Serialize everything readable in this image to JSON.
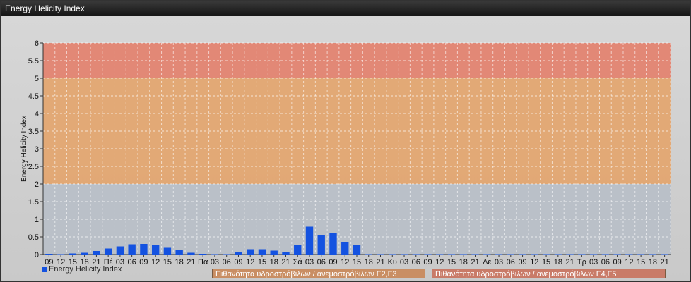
{
  "window": {
    "title": "Energy Helicity Index"
  },
  "colors": {
    "bar": "#1452e0",
    "band_low": "#b8bfc8",
    "band_mid": "#e3a46c",
    "band_high": "#e3806c",
    "legend_mid": "#c98e63",
    "legend_high": "#c97b68"
  },
  "legend": {
    "series_label": "Energy Helicity Index",
    "band_mid_label": "Πιθανότητα υδροστρόβιλων / ανεμοστρόβιλων F2,F3",
    "band_high_label": "Πιθανότητα υδροστρόβιλων / ανεμοστρόβιλων F4,F5"
  },
  "chart_data": {
    "type": "bar",
    "ylabel": "Energy Helicity Index",
    "ylim": [
      0,
      6
    ],
    "yticks": [
      "0",
      "0.5",
      "1",
      "1.5",
      "2",
      "2.5",
      "3",
      "3.5",
      "4",
      "4.5",
      "5",
      "5.5",
      "6"
    ],
    "bands": [
      {
        "from": 0,
        "to": 2,
        "label": ""
      },
      {
        "from": 2,
        "to": 5,
        "label": "Πιθανότητα υδροστρόβιλων / ανεμοστρόβιλων F2,F3"
      },
      {
        "from": 5,
        "to": 6,
        "label": "Πιθανότητα υδροστρόβιλων / ανεμοστρόβιλων F4,F5"
      }
    ],
    "grid": true,
    "categories": [
      "09",
      "12",
      "15",
      "18",
      "21",
      "Πέ",
      "03",
      "06",
      "09",
      "12",
      "15",
      "18",
      "21",
      "Πα",
      "03",
      "06",
      "09",
      "12",
      "15",
      "18",
      "21",
      "Σά",
      "03",
      "06",
      "09",
      "12",
      "15",
      "18",
      "21",
      "Κυ",
      "03",
      "06",
      "09",
      "12",
      "15",
      "18",
      "21",
      "Δε",
      "03",
      "06",
      "09",
      "12",
      "15",
      "18",
      "21",
      "Τρ",
      "03",
      "06",
      "09",
      "12",
      "15",
      "18",
      "21"
    ],
    "series": [
      {
        "name": "Energy Helicity Index",
        "values": [
          0.02,
          0.01,
          0.03,
          0.05,
          0.1,
          0.17,
          0.23,
          0.29,
          0.3,
          0.27,
          0.19,
          0.12,
          0.05,
          0.02,
          0.01,
          0.01,
          0.06,
          0.15,
          0.15,
          0.11,
          0.06,
          0.27,
          0.79,
          0.55,
          0.6,
          0.36,
          0.26,
          0.01,
          0.01,
          0.01,
          0.01,
          0.01,
          0.01,
          0.01,
          0.01,
          0.01,
          0.01,
          0.01,
          0.01,
          0.01,
          0.01,
          0.01,
          0.01,
          0.01,
          0.01,
          0.01,
          0.01,
          0.01,
          0.01,
          0.01,
          0.01,
          0.01,
          0.01
        ]
      }
    ]
  }
}
